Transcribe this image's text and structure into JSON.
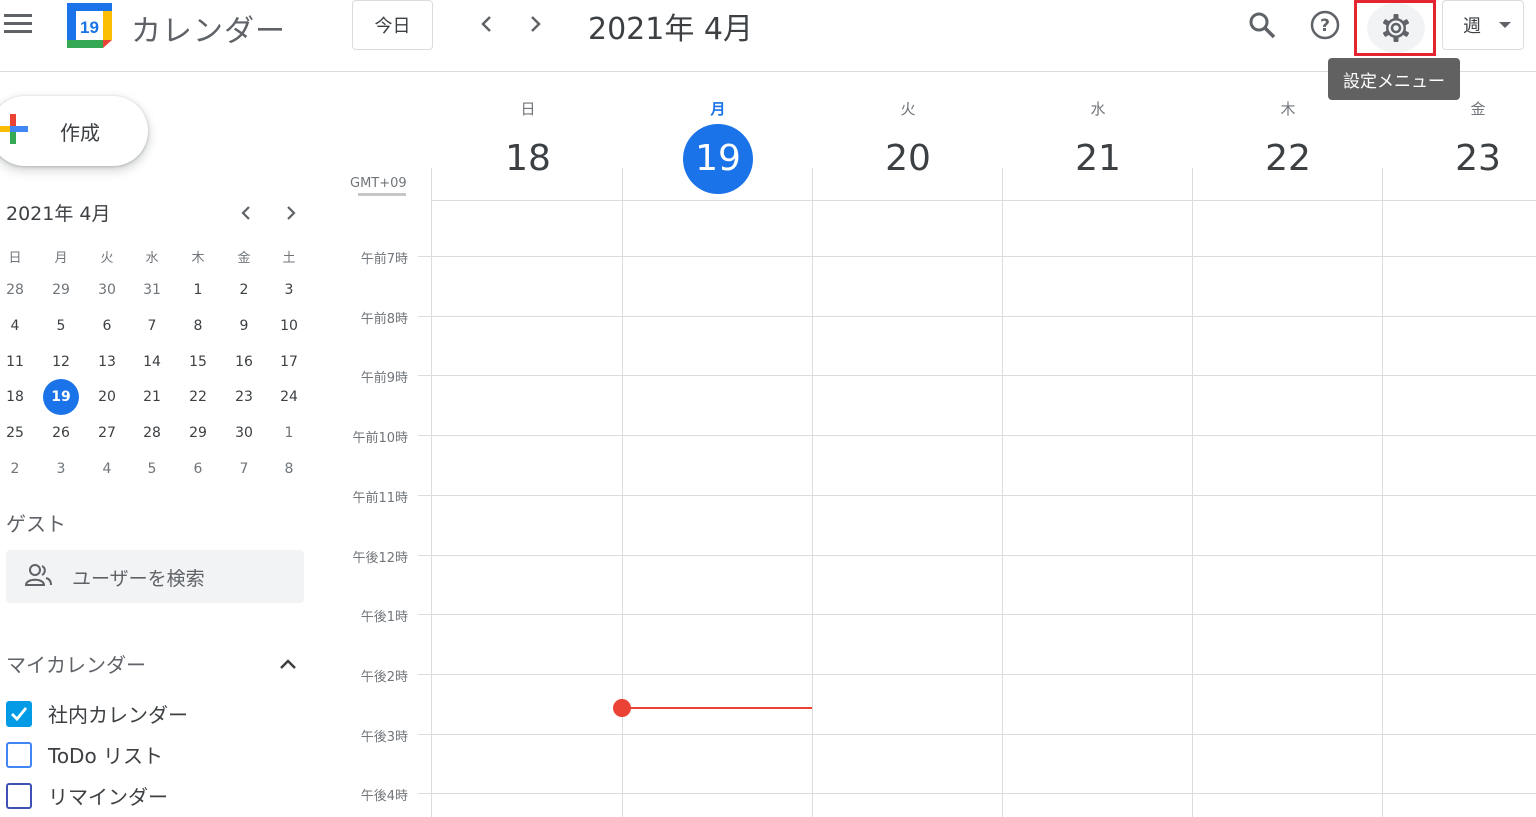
{
  "header": {
    "app_title": "カレンダー",
    "logo_day": "19",
    "today_label": "今日",
    "current_period": "2021年 4月",
    "view_label": "週",
    "settings_tooltip": "設定メニュー"
  },
  "sidebar": {
    "create_label": "作成",
    "mini_calendar": {
      "title": "2021年 4月",
      "weekdays": [
        "日",
        "月",
        "火",
        "水",
        "木",
        "金",
        "土"
      ],
      "weeks": [
        [
          "28",
          "29",
          "30",
          "31",
          "1",
          "2",
          "3"
        ],
        [
          "4",
          "5",
          "6",
          "7",
          "8",
          "9",
          "10"
        ],
        [
          "11",
          "12",
          "13",
          "14",
          "15",
          "16",
          "17"
        ],
        [
          "18",
          "19",
          "20",
          "21",
          "22",
          "23",
          "24"
        ],
        [
          "25",
          "26",
          "27",
          "28",
          "29",
          "30",
          "1"
        ],
        [
          "2",
          "3",
          "4",
          "5",
          "6",
          "7",
          "8"
        ]
      ],
      "today": "19"
    },
    "guest_title": "ゲスト",
    "guest_search_placeholder": "ユーザーを検索",
    "my_calendars_title": "マイカレンダー",
    "calendars": [
      {
        "label": "社内カレンダー",
        "checked": true,
        "color": "#039be5"
      },
      {
        "label": "ToDo リスト",
        "checked": false,
        "color": "#4285f4"
      },
      {
        "label": "リマインダー",
        "checked": false,
        "color": "#3f51b5"
      }
    ]
  },
  "week_view": {
    "timezone": "GMT+09",
    "days": [
      {
        "dow": "日",
        "num": "18"
      },
      {
        "dow": "月",
        "num": "19",
        "today": true
      },
      {
        "dow": "火",
        "num": "20"
      },
      {
        "dow": "水",
        "num": "21"
      },
      {
        "dow": "木",
        "num": "22"
      },
      {
        "dow": "金",
        "num": "23"
      }
    ],
    "hours": [
      "午前7時",
      "午前8時",
      "午前9時",
      "午前10時",
      "午前11時",
      "午後12時",
      "午後1時",
      "午後2時",
      "午後3時",
      "午後4時"
    ]
  },
  "colors": {
    "accent": "#1a73e8",
    "now_indicator": "#ea4335",
    "settings_highlight": "#e2252e"
  }
}
